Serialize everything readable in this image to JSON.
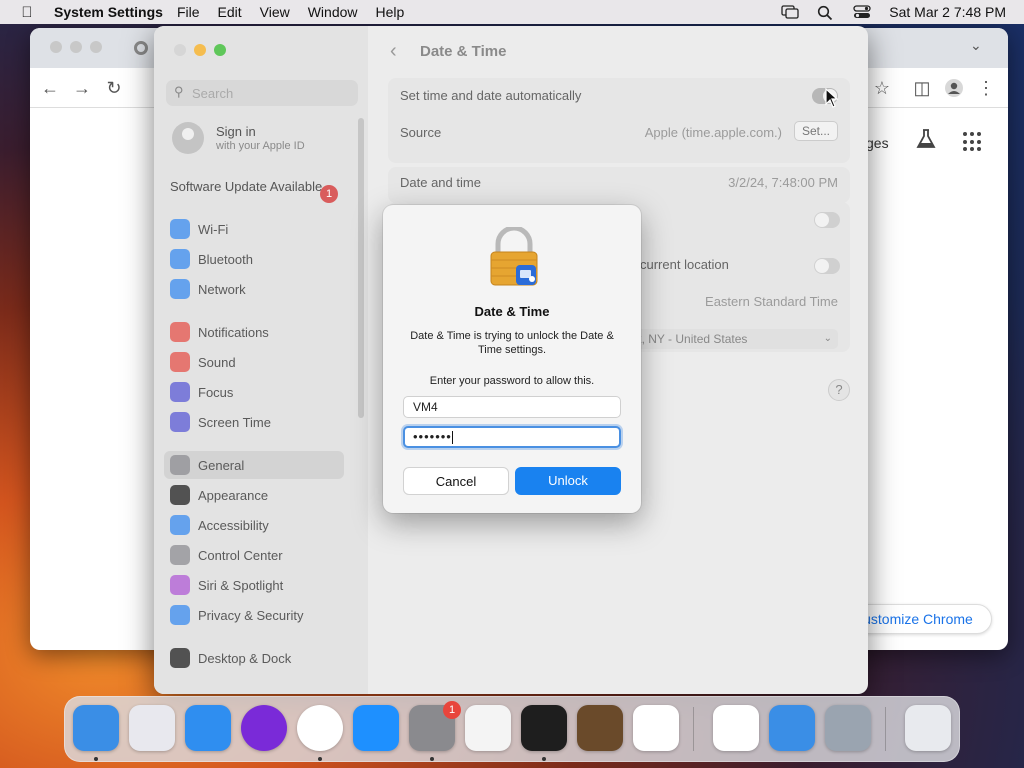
{
  "menubar": {
    "app_name": "System Settings",
    "items": [
      "File",
      "Edit",
      "View",
      "Window",
      "Help"
    ],
    "clock": "Sat Mar 2  7:48 PM"
  },
  "chrome": {
    "ntp_link_partial": "ges",
    "customize_label": "Customize Chrome"
  },
  "settings": {
    "search_placeholder": "Search",
    "signin": {
      "name": "Sign in",
      "sub": "with your Apple ID"
    },
    "software_update": {
      "label": "Software Update Available",
      "badge": "1"
    },
    "sidebar": [
      {
        "label": "Wi-Fi",
        "icon": "wifi-icon",
        "color": "#3b8cf0"
      },
      {
        "label": "Bluetooth",
        "icon": "bluetooth-icon",
        "color": "#3b8cf0"
      },
      {
        "label": "Network",
        "icon": "network-icon",
        "color": "#3b8cf0"
      },
      {
        "label": "Notifications",
        "icon": "notifications-icon",
        "color": "#e5534b"
      },
      {
        "label": "Sound",
        "icon": "sound-icon",
        "color": "#e5534b"
      },
      {
        "label": "Focus",
        "icon": "focus-icon",
        "color": "#5b5bd6"
      },
      {
        "label": "Screen Time",
        "icon": "screen-time-icon",
        "color": "#5b5bd6"
      },
      {
        "label": "General",
        "icon": "gear-icon",
        "color": "#8e8e93"
      },
      {
        "label": "Appearance",
        "icon": "appearance-icon",
        "color": "#222222"
      },
      {
        "label": "Accessibility",
        "icon": "accessibility-icon",
        "color": "#3b8cf0"
      },
      {
        "label": "Control Center",
        "icon": "control-center-icon",
        "color": "#8e8e93"
      },
      {
        "label": "Siri & Spotlight",
        "icon": "siri-icon",
        "color": "#b05bd6"
      },
      {
        "label": "Privacy & Security",
        "icon": "hand-icon",
        "color": "#3b8cf0"
      },
      {
        "label": "Desktop & Dock",
        "icon": "dock-icon",
        "color": "#222222"
      }
    ],
    "page_title": "Date & Time",
    "rows": {
      "auto_label": "Set time and date automatically",
      "source_label": "Source",
      "source_value": "Apple (time.apple.com.)",
      "set_button": "Set...",
      "date_time_label": "Date and time",
      "date_time_value": "3/2/24, 7:48:00 PM",
      "location_label_partial": "current location",
      "timezone_value": "Eastern Standard Time",
      "closest_city_partial": "York, NY - United States",
      "help": "?"
    }
  },
  "dialog": {
    "title": "Date & Time",
    "message": "Date & Time is trying to unlock the Date & Time settings.",
    "prompt": "Enter your password to allow this.",
    "username": "VM4",
    "password_mask": "•••••••",
    "cancel_label": "Cancel",
    "unlock_label": "Unlock"
  },
  "dock": {
    "apps": [
      {
        "name": "finder-icon",
        "color": "#3a8ee6",
        "running": true
      },
      {
        "name": "launchpad-icon",
        "color": "#e8e8ee",
        "running": false
      },
      {
        "name": "safari-icon",
        "color": "#2f8ef0",
        "running": false
      },
      {
        "name": "firefox-icon",
        "color": "#7a2ad8",
        "running": false
      },
      {
        "name": "chrome-icon",
        "color": "#ffffff",
        "running": true
      },
      {
        "name": "app-store-icon",
        "color": "#1e90ff",
        "running": false
      },
      {
        "name": "system-settings-icon",
        "color": "#8a8a8e",
        "running": true,
        "badge": "1"
      },
      {
        "name": "textedit-icon",
        "color": "#f4f4f4",
        "running": false
      },
      {
        "name": "terminal-icon",
        "color": "#1e1e1e",
        "running": true
      },
      {
        "name": "garageband-icon",
        "color": "#6a4a2a",
        "running": false
      },
      {
        "name": "vscode-icon",
        "color": "#ffffff",
        "running": false
      },
      {
        "name": "visual-studio-icon",
        "color": "#ffffff",
        "running": false
      },
      {
        "name": "weather-icon",
        "color": "#3a8ee6",
        "running": false
      },
      {
        "name": "finder-folder-icon",
        "color": "#9aa4b0",
        "running": false
      },
      {
        "name": "trash-icon",
        "color": "#e8eaee",
        "running": false
      }
    ]
  }
}
